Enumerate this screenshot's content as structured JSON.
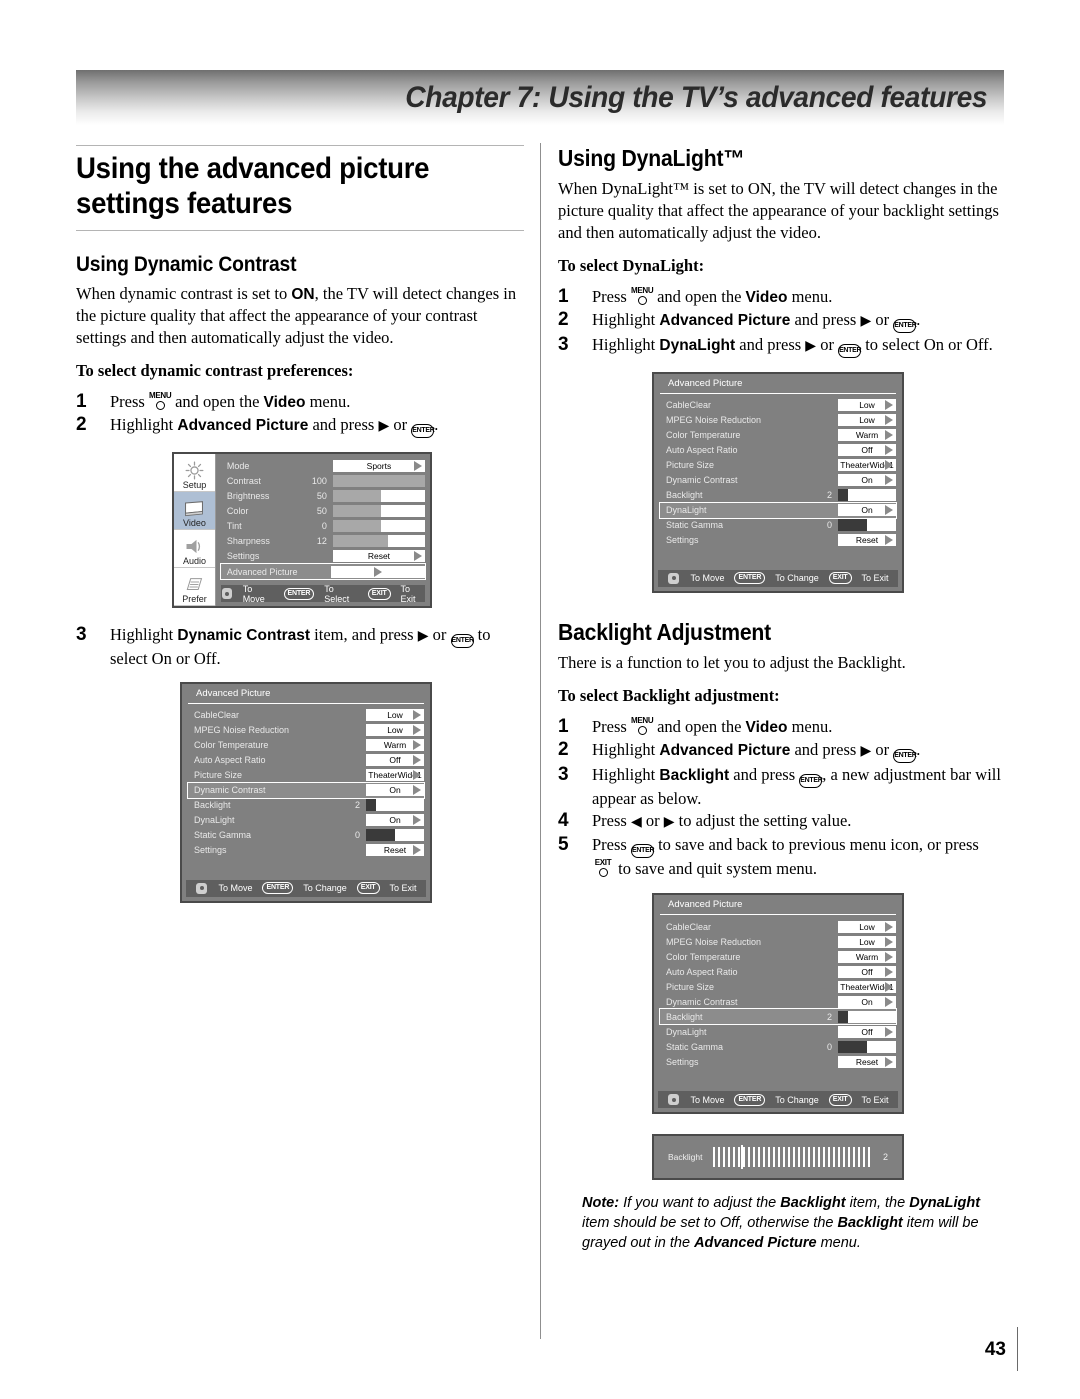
{
  "chapter": {
    "title": "Chapter 7: Using the TV’s advanced features"
  },
  "page": {
    "number": "43"
  },
  "icons": {
    "menu_key": "MENU",
    "exit_key": "EXIT",
    "enter_key": "ENTER",
    "right_arrow": "▶",
    "left_arrow": "◀"
  },
  "left_column": {
    "heading": "Using the advanced picture settings features",
    "section1": {
      "title": "Using Dynamic Contrast",
      "paragraph": "When dynamic contrast is set to ON, the TV will detect changes in the picture quality that affect the appearance of your contrast settings and then automatically adjust the video.",
      "paragraph_bold_term": "ON",
      "lead": "To select dynamic contrast preferences:",
      "steps": [
        {
          "num": "1",
          "pre": "Press ",
          "key": "MENU",
          "mid": " and open the ",
          "bold": "Video",
          "post": " menu."
        },
        {
          "num": "2",
          "pre": "Highlight ",
          "bold": "Advanced Picture",
          "mid": " and press ",
          "arrow": "▶",
          "mid2": " or ",
          "key": "ENTER",
          "post": "."
        },
        {
          "num": "3",
          "pre": "Highlight ",
          "bold": "Dynamic Contrast",
          "mid": " item, and press ",
          "arrow": "▶",
          "mid2": " or ",
          "key": "ENTER",
          "post": " to select On or Off."
        }
      ]
    }
  },
  "right_column": {
    "section_dynalight": {
      "title": "Using DynaLight™",
      "paragraph": "When DynaLight™ is set to ON, the TV will detect changes in the picture quality that affect the appearance of your backlight settings and then automatically adjust the video.",
      "lead": "To select DynaLight:",
      "steps": [
        {
          "num": "1",
          "pre": "Press ",
          "key": "MENU",
          "mid": " and open the ",
          "bold": "Video",
          "post": " menu."
        },
        {
          "num": "2",
          "pre": "Highlight ",
          "bold": "Advanced Picture",
          "mid": " and press ",
          "arrow": "▶",
          "mid2": " or ",
          "key": "ENTER",
          "post": "."
        },
        {
          "num": "3",
          "pre": "Highlight ",
          "bold": "DynaLight",
          "mid": " and press ",
          "arrow": "▶",
          "mid2": " or ",
          "key": "ENTER",
          "post": " to select On or Off."
        }
      ]
    },
    "section_backlight": {
      "title": "Backlight Adjustment",
      "paragraph": "There is a function to let you to adjust the Backlight.",
      "lead": "To select Backlight adjustment:",
      "steps": [
        {
          "num": "1",
          "pre": "Press ",
          "key": "MENU",
          "mid": " and open the ",
          "bold": "Video",
          "post": " menu."
        },
        {
          "num": "2",
          "pre": "Highlight ",
          "bold": "Advanced Picture",
          "mid": " and press ",
          "arrow": "▶",
          "mid2": " or ",
          "key": "ENTER",
          "post": "."
        },
        {
          "num": "3",
          "pre": "Highlight ",
          "bold": "Backlight",
          "mid": " and press ",
          "key": "ENTER",
          "post": ", a new adjustment bar will appear as below."
        },
        {
          "num": "4",
          "pre": "Press ",
          "arrow_l": "◀",
          "mid": " or ",
          "arrow": "▶",
          "post": " to adjust the setting value."
        },
        {
          "num": "5",
          "pre": "Press ",
          "key": "ENTER",
          "post": " to save and back to previous menu icon, or press EXIT to save and quit system menu."
        }
      ]
    },
    "note": {
      "label": "Note:",
      "line1_a": " If you want to adjust the ",
      "line1_b": "Backlight",
      "line1_c": " item, the ",
      "line2_a": "DynaLight",
      "line2_b": " item should be set to Off, otherwise the ",
      "line3_a": "Backlight",
      "line3_b": " item will be grayed out in the ",
      "line3_c": "Advanced Picture",
      "line4": " menu."
    }
  },
  "osd_video_menu": {
    "sidebar": [
      {
        "label": "Setup",
        "icon": "sun-icon",
        "active": false
      },
      {
        "label": "Video",
        "icon": "tv-icon",
        "active": true
      },
      {
        "label": "Audio",
        "icon": "speaker-icon",
        "active": false
      },
      {
        "label": "Prefer",
        "icon": "list-icon",
        "active": false
      }
    ],
    "rows": [
      {
        "label": "Mode",
        "value": "Sports",
        "type": "select"
      },
      {
        "label": "Contrast",
        "num": "100",
        "fill": 100,
        "type": "bar"
      },
      {
        "label": "Brightness",
        "num": "50",
        "fill": 52,
        "type": "bar"
      },
      {
        "label": "Color",
        "num": "50",
        "fill": 52,
        "type": "bar"
      },
      {
        "label": "Tint",
        "num": "0",
        "fill": 52,
        "type": "bar"
      },
      {
        "label": "Sharpness",
        "num": "12",
        "fill": 60,
        "type": "bar"
      },
      {
        "label": "Settings",
        "value": "Reset",
        "type": "select"
      },
      {
        "label": "Advanced Picture",
        "value": "",
        "type": "submenu",
        "selected": true
      }
    ],
    "footer": {
      "move": "To Move",
      "enter_key": "ENTER",
      "enter_action": "To Select",
      "exit_key": "EXIT",
      "exit_action": "To Exit"
    }
  },
  "osd_advanced_dynamic_contrast": {
    "title": "Advanced Picture",
    "rows": [
      {
        "label": "CableClear",
        "value": "Low",
        "type": "select"
      },
      {
        "label": "MPEG Noise Reduction",
        "value": "Low",
        "type": "select"
      },
      {
        "label": "Color Temperature",
        "value": "Warm",
        "type": "select"
      },
      {
        "label": "Auto Aspect Ratio",
        "value": "Off",
        "type": "select"
      },
      {
        "label": "Picture Size",
        "value": "TheaterWide1",
        "type": "select"
      },
      {
        "label": "Dynamic Contrast",
        "value": "On",
        "type": "select",
        "selected": true
      },
      {
        "label": "Backlight",
        "num": "2",
        "fill": 18,
        "type": "bar"
      },
      {
        "label": "DynaLight",
        "value": "On",
        "type": "select"
      },
      {
        "label": "Static Gamma",
        "num": "0",
        "fill": 50,
        "type": "bar"
      },
      {
        "label": "Settings",
        "value": "Reset",
        "type": "select"
      }
    ],
    "footer": {
      "move": "To Move",
      "enter_key": "ENTER",
      "enter_action": "To Change",
      "exit_key": "EXIT",
      "exit_action": "To Exit"
    }
  },
  "osd_advanced_dynalight": {
    "title": "Advanced Picture",
    "rows": [
      {
        "label": "CableClear",
        "value": "Low",
        "type": "select"
      },
      {
        "label": "MPEG Noise Reduction",
        "value": "Low",
        "type": "select"
      },
      {
        "label": "Color Temperature",
        "value": "Warm",
        "type": "select"
      },
      {
        "label": "Auto Aspect Ratio",
        "value": "Off",
        "type": "select"
      },
      {
        "label": "Picture Size",
        "value": "TheaterWide1",
        "type": "select"
      },
      {
        "label": "Dynamic Contrast",
        "value": "On",
        "type": "select"
      },
      {
        "label": "Backlight",
        "num": "2",
        "fill": 18,
        "type": "bar"
      },
      {
        "label": "DynaLight",
        "value": "On",
        "type": "select",
        "selected": true
      },
      {
        "label": "Static Gamma",
        "num": "0",
        "fill": 50,
        "type": "bar"
      },
      {
        "label": "Settings",
        "value": "Reset",
        "type": "select"
      }
    ],
    "footer": {
      "move": "To Move",
      "enter_key": "ENTER",
      "enter_action": "To Change",
      "exit_key": "EXIT",
      "exit_action": "To Exit"
    }
  },
  "osd_advanced_backlight": {
    "title": "Advanced Picture",
    "rows": [
      {
        "label": "CableClear",
        "value": "Low",
        "type": "select"
      },
      {
        "label": "MPEG Noise Reduction",
        "value": "Low",
        "type": "select"
      },
      {
        "label": "Color Temperature",
        "value": "Warm",
        "type": "select"
      },
      {
        "label": "Auto Aspect Ratio",
        "value": "Off",
        "type": "select"
      },
      {
        "label": "Picture Size",
        "value": "TheaterWide1",
        "type": "select"
      },
      {
        "label": "Dynamic Contrast",
        "value": "On",
        "type": "select"
      },
      {
        "label": "Backlight",
        "num": "2",
        "fill": 18,
        "type": "bar",
        "selected": true
      },
      {
        "label": "DynaLight",
        "value": "Off",
        "type": "select"
      },
      {
        "label": "Static Gamma",
        "num": "0",
        "fill": 50,
        "type": "bar"
      },
      {
        "label": "Settings",
        "value": "Reset",
        "type": "select"
      }
    ],
    "footer": {
      "move": "To Move",
      "enter_key": "ENTER",
      "enter_action": "To Change",
      "exit_key": "EXIT",
      "exit_action": "To Exit"
    }
  },
  "osd_backlight_bar": {
    "label": "Backlight",
    "value": "2",
    "cursor_percent": 18
  },
  "colors": {
    "osd_background": "#808080",
    "osd_border": "#4a4a4a",
    "osd_footer": "#5f5f5f",
    "sidebar_active": "#aebfd4",
    "bar_fill_dark": "#3a3a3a",
    "bar_fill_gray": "#a8a8a8",
    "rule": "#b4b4b4"
  }
}
